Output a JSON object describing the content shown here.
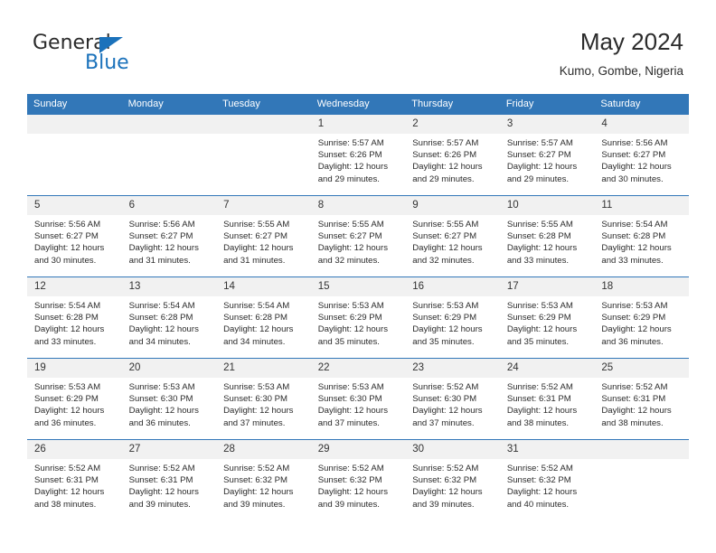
{
  "brand": {
    "name_top": "General",
    "name_bottom": "Blue",
    "accent_color": "#1b72bb"
  },
  "header": {
    "title": "May 2024",
    "subtitle": "Kumo, Gombe, Nigeria"
  },
  "theme": {
    "header_row_bg": "#3277b8",
    "day_number_bg": "#f1f1f1",
    "grid_line": "#3277b8",
    "text": "#2b2b2b"
  },
  "calendar": {
    "weekday_headers": [
      "Sunday",
      "Monday",
      "Tuesday",
      "Wednesday",
      "Thursday",
      "Friday",
      "Saturday"
    ],
    "labels": {
      "sunrise": "Sunrise:",
      "sunset": "Sunset:",
      "daylight": "Daylight:"
    },
    "weeks": [
      [
        {
          "day": "",
          "empty": true
        },
        {
          "day": "",
          "empty": true
        },
        {
          "day": "",
          "empty": true
        },
        {
          "day": "1",
          "sunrise": "Sunrise: 5:57 AM",
          "sunset": "Sunset: 6:26 PM",
          "daylight_1": "Daylight: 12 hours",
          "daylight_2": "and 29 minutes."
        },
        {
          "day": "2",
          "sunrise": "Sunrise: 5:57 AM",
          "sunset": "Sunset: 6:26 PM",
          "daylight_1": "Daylight: 12 hours",
          "daylight_2": "and 29 minutes."
        },
        {
          "day": "3",
          "sunrise": "Sunrise: 5:57 AM",
          "sunset": "Sunset: 6:27 PM",
          "daylight_1": "Daylight: 12 hours",
          "daylight_2": "and 29 minutes."
        },
        {
          "day": "4",
          "sunrise": "Sunrise: 5:56 AM",
          "sunset": "Sunset: 6:27 PM",
          "daylight_1": "Daylight: 12 hours",
          "daylight_2": "and 30 minutes."
        }
      ],
      [
        {
          "day": "5",
          "sunrise": "Sunrise: 5:56 AM",
          "sunset": "Sunset: 6:27 PM",
          "daylight_1": "Daylight: 12 hours",
          "daylight_2": "and 30 minutes."
        },
        {
          "day": "6",
          "sunrise": "Sunrise: 5:56 AM",
          "sunset": "Sunset: 6:27 PM",
          "daylight_1": "Daylight: 12 hours",
          "daylight_2": "and 31 minutes."
        },
        {
          "day": "7",
          "sunrise": "Sunrise: 5:55 AM",
          "sunset": "Sunset: 6:27 PM",
          "daylight_1": "Daylight: 12 hours",
          "daylight_2": "and 31 minutes."
        },
        {
          "day": "8",
          "sunrise": "Sunrise: 5:55 AM",
          "sunset": "Sunset: 6:27 PM",
          "daylight_1": "Daylight: 12 hours",
          "daylight_2": "and 32 minutes."
        },
        {
          "day": "9",
          "sunrise": "Sunrise: 5:55 AM",
          "sunset": "Sunset: 6:27 PM",
          "daylight_1": "Daylight: 12 hours",
          "daylight_2": "and 32 minutes."
        },
        {
          "day": "10",
          "sunrise": "Sunrise: 5:55 AM",
          "sunset": "Sunset: 6:28 PM",
          "daylight_1": "Daylight: 12 hours",
          "daylight_2": "and 33 minutes."
        },
        {
          "day": "11",
          "sunrise": "Sunrise: 5:54 AM",
          "sunset": "Sunset: 6:28 PM",
          "daylight_1": "Daylight: 12 hours",
          "daylight_2": "and 33 minutes."
        }
      ],
      [
        {
          "day": "12",
          "sunrise": "Sunrise: 5:54 AM",
          "sunset": "Sunset: 6:28 PM",
          "daylight_1": "Daylight: 12 hours",
          "daylight_2": "and 33 minutes."
        },
        {
          "day": "13",
          "sunrise": "Sunrise: 5:54 AM",
          "sunset": "Sunset: 6:28 PM",
          "daylight_1": "Daylight: 12 hours",
          "daylight_2": "and 34 minutes."
        },
        {
          "day": "14",
          "sunrise": "Sunrise: 5:54 AM",
          "sunset": "Sunset: 6:28 PM",
          "daylight_1": "Daylight: 12 hours",
          "daylight_2": "and 34 minutes."
        },
        {
          "day": "15",
          "sunrise": "Sunrise: 5:53 AM",
          "sunset": "Sunset: 6:29 PM",
          "daylight_1": "Daylight: 12 hours",
          "daylight_2": "and 35 minutes."
        },
        {
          "day": "16",
          "sunrise": "Sunrise: 5:53 AM",
          "sunset": "Sunset: 6:29 PM",
          "daylight_1": "Daylight: 12 hours",
          "daylight_2": "and 35 minutes."
        },
        {
          "day": "17",
          "sunrise": "Sunrise: 5:53 AM",
          "sunset": "Sunset: 6:29 PM",
          "daylight_1": "Daylight: 12 hours",
          "daylight_2": "and 35 minutes."
        },
        {
          "day": "18",
          "sunrise": "Sunrise: 5:53 AM",
          "sunset": "Sunset: 6:29 PM",
          "daylight_1": "Daylight: 12 hours",
          "daylight_2": "and 36 minutes."
        }
      ],
      [
        {
          "day": "19",
          "sunrise": "Sunrise: 5:53 AM",
          "sunset": "Sunset: 6:29 PM",
          "daylight_1": "Daylight: 12 hours",
          "daylight_2": "and 36 minutes."
        },
        {
          "day": "20",
          "sunrise": "Sunrise: 5:53 AM",
          "sunset": "Sunset: 6:30 PM",
          "daylight_1": "Daylight: 12 hours",
          "daylight_2": "and 36 minutes."
        },
        {
          "day": "21",
          "sunrise": "Sunrise: 5:53 AM",
          "sunset": "Sunset: 6:30 PM",
          "daylight_1": "Daylight: 12 hours",
          "daylight_2": "and 37 minutes."
        },
        {
          "day": "22",
          "sunrise": "Sunrise: 5:53 AM",
          "sunset": "Sunset: 6:30 PM",
          "daylight_1": "Daylight: 12 hours",
          "daylight_2": "and 37 minutes."
        },
        {
          "day": "23",
          "sunrise": "Sunrise: 5:52 AM",
          "sunset": "Sunset: 6:30 PM",
          "daylight_1": "Daylight: 12 hours",
          "daylight_2": "and 37 minutes."
        },
        {
          "day": "24",
          "sunrise": "Sunrise: 5:52 AM",
          "sunset": "Sunset: 6:31 PM",
          "daylight_1": "Daylight: 12 hours",
          "daylight_2": "and 38 minutes."
        },
        {
          "day": "25",
          "sunrise": "Sunrise: 5:52 AM",
          "sunset": "Sunset: 6:31 PM",
          "daylight_1": "Daylight: 12 hours",
          "daylight_2": "and 38 minutes."
        }
      ],
      [
        {
          "day": "26",
          "sunrise": "Sunrise: 5:52 AM",
          "sunset": "Sunset: 6:31 PM",
          "daylight_1": "Daylight: 12 hours",
          "daylight_2": "and 38 minutes."
        },
        {
          "day": "27",
          "sunrise": "Sunrise: 5:52 AM",
          "sunset": "Sunset: 6:31 PM",
          "daylight_1": "Daylight: 12 hours",
          "daylight_2": "and 39 minutes."
        },
        {
          "day": "28",
          "sunrise": "Sunrise: 5:52 AM",
          "sunset": "Sunset: 6:32 PM",
          "daylight_1": "Daylight: 12 hours",
          "daylight_2": "and 39 minutes."
        },
        {
          "day": "29",
          "sunrise": "Sunrise: 5:52 AM",
          "sunset": "Sunset: 6:32 PM",
          "daylight_1": "Daylight: 12 hours",
          "daylight_2": "and 39 minutes."
        },
        {
          "day": "30",
          "sunrise": "Sunrise: 5:52 AM",
          "sunset": "Sunset: 6:32 PM",
          "daylight_1": "Daylight: 12 hours",
          "daylight_2": "and 39 minutes."
        },
        {
          "day": "31",
          "sunrise": "Sunrise: 5:52 AM",
          "sunset": "Sunset: 6:32 PM",
          "daylight_1": "Daylight: 12 hours",
          "daylight_2": "and 40 minutes."
        },
        {
          "day": "",
          "empty": true
        }
      ]
    ]
  }
}
